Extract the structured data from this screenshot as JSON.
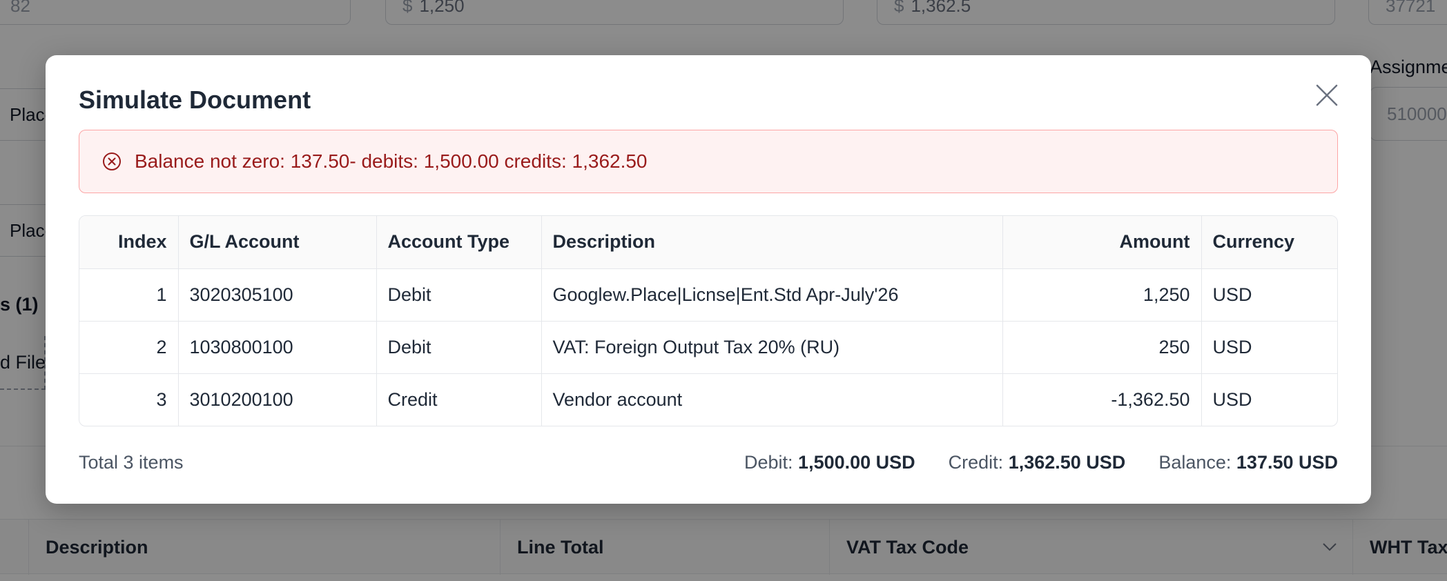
{
  "background": {
    "inputs": [
      {
        "value": "82",
        "prefix": ""
      },
      {
        "value": "1,250",
        "prefix": "$"
      },
      {
        "value": "1,362.5",
        "prefix": "$"
      },
      {
        "value": "37721",
        "prefix": ""
      }
    ],
    "assignment_label": "Assignme",
    "assignment_value": "510000",
    "fragments": {
      "place_1": "Place|",
      "place_2": "Place|",
      "attachments_count": "s (1)",
      "upload_file": "d File"
    },
    "table_headers": {
      "description": "Description",
      "line_total": "Line Total",
      "vat_tax_code": "VAT Tax Code",
      "wht_tax_code": "WHT Tax C"
    }
  },
  "modal": {
    "title": "Simulate Document",
    "alert": {
      "message": "Balance not zero: 137.50- debits: 1,500.00 credits: 1,362.50",
      "color": "#991b1b"
    },
    "table": {
      "headers": {
        "index": "Index",
        "gl_account": "G/L Account",
        "account_type": "Account Type",
        "description": "Description",
        "amount": "Amount",
        "currency": "Currency"
      },
      "rows": [
        {
          "index": "1",
          "gl_account": "3020305100",
          "account_type": "Debit",
          "description": "Googlew.Place|Licnse|Ent.Std Apr-July'26",
          "amount": "1,250",
          "currency": "USD"
        },
        {
          "index": "2",
          "gl_account": "1030800100",
          "account_type": "Debit",
          "description": "VAT: Foreign Output Tax 20% (RU)",
          "amount": "250",
          "currency": "USD"
        },
        {
          "index": "3",
          "gl_account": "3010200100",
          "account_type": "Credit",
          "description": "Vendor account",
          "amount": "-1,362.50",
          "currency": "USD"
        }
      ]
    },
    "footer": {
      "total_items": "Total 3 items",
      "debit_label": "Debit:",
      "debit_value": "1,500.00 USD",
      "credit_label": "Credit:",
      "credit_value": "1,362.50 USD",
      "balance_label": "Balance:",
      "balance_value": "137.50 USD"
    }
  }
}
